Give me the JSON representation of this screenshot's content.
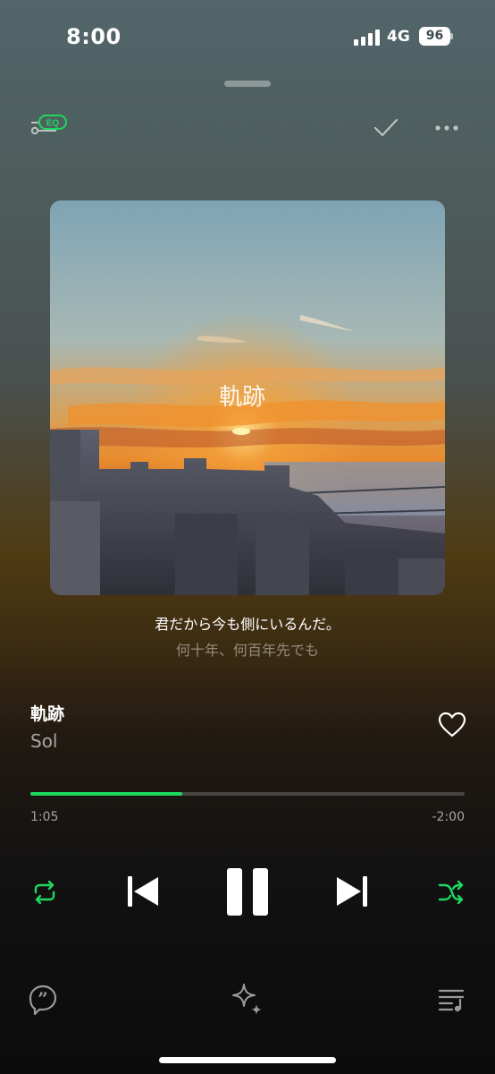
{
  "status_bar": {
    "time": "8:00",
    "network": "4G",
    "battery": "96"
  },
  "header": {
    "eq_label": "EQ"
  },
  "album_art": {
    "title_text": "軌跡",
    "icon": "album-art"
  },
  "lyrics": {
    "current": "君だから今も側にいるんだ。",
    "next": "何十年、何百年先でも"
  },
  "track": {
    "title": "軌跡",
    "artist": "Sol"
  },
  "playback": {
    "elapsed": "1:05",
    "remaining": "-2:00",
    "progress": 0.35
  },
  "colors": {
    "accent": "#1ed760"
  },
  "icons": {
    "eq": "eq-icon",
    "check": "check-icon",
    "more": "more-icon",
    "heart": "heart-icon",
    "repeat": "repeat-icon",
    "prev": "skip-previous-icon",
    "pause": "pause-icon",
    "next": "skip-next-icon",
    "shuffle": "shuffle-icon",
    "lyrics": "lyrics-quote-icon",
    "ai": "sparkle-icon",
    "queue": "queue-icon"
  }
}
